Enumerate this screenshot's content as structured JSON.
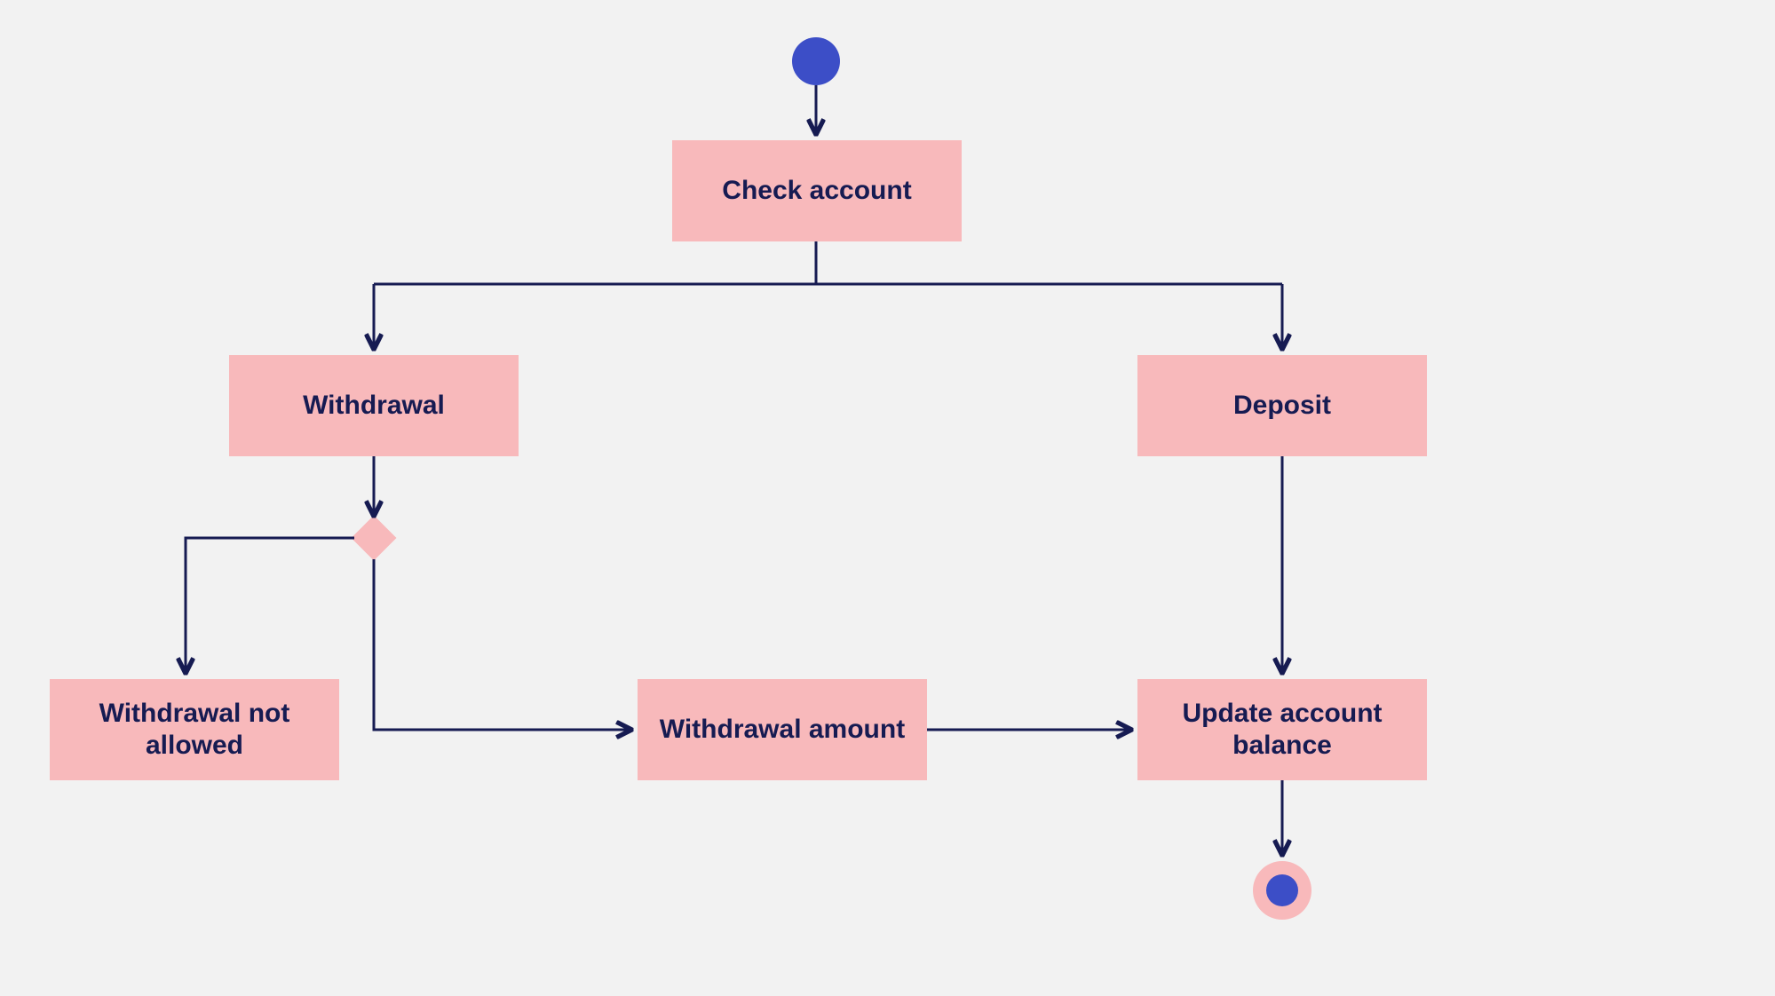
{
  "diagram": {
    "type": "activity-flowchart",
    "start": "start-node",
    "end": "end-node",
    "nodes": {
      "check_account": {
        "label": "Check account"
      },
      "withdrawal": {
        "label": "Withdrawal"
      },
      "deposit": {
        "label": "Deposit"
      },
      "withdrawal_not_allowed": {
        "label": "Withdrawal not allowed"
      },
      "withdrawal_amount": {
        "label": "Withdrawal amount"
      },
      "update_balance": {
        "label": "Update account balance"
      }
    },
    "decision": "withdrawal-decision",
    "edges": [
      [
        "start-node",
        "check_account"
      ],
      [
        "check_account",
        "withdrawal"
      ],
      [
        "check_account",
        "deposit"
      ],
      [
        "withdrawal",
        "withdrawal-decision"
      ],
      [
        "withdrawal-decision",
        "withdrawal_not_allowed"
      ],
      [
        "withdrawal-decision",
        "withdrawal_amount"
      ],
      [
        "withdrawal_amount",
        "update_balance"
      ],
      [
        "deposit",
        "update_balance"
      ],
      [
        "update_balance",
        "end-node"
      ]
    ],
    "colors": {
      "node_fill": "#f8b9bb",
      "node_text": "#161b52",
      "edge": "#161b52",
      "start_end": "#3c4ec7",
      "canvas": "#f2f2f2"
    }
  }
}
